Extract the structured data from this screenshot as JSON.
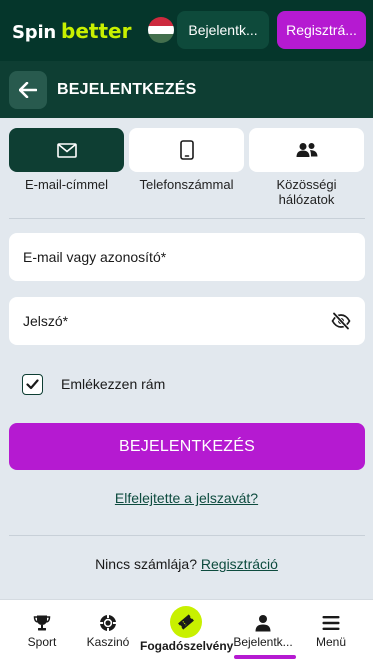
{
  "header": {
    "logo_spin": "Spin",
    "logo_better": "better",
    "flag": "hungary-flag",
    "login_button": "Bejelentk...",
    "register_button": "Regisztrá..."
  },
  "subheader": {
    "back_icon": "arrow-left-icon",
    "title": "BEJELENTKEZÉS"
  },
  "login_methods": [
    {
      "label": "E-mail-címmel",
      "icon": "envelope-icon",
      "active": true
    },
    {
      "label": "Telefonszámmal",
      "icon": "phone-icon",
      "active": false
    },
    {
      "label": "Közösségi hálózatok",
      "icon": "users-icon",
      "active": false
    }
  ],
  "form": {
    "email_label": "E-mail vagy azonosító*",
    "password_label": "Jelszó*",
    "remember_label": "Emlékezzen rám",
    "remember_checked": true,
    "submit_label": "BEJELENTKEZÉS",
    "forgot_link": "Elfelejtette a jelszavát?",
    "no_account_text": "Nincs számlája?",
    "register_link": "Regisztráció"
  },
  "bottom_nav": [
    {
      "label": "Sport",
      "icon": "trophy-icon"
    },
    {
      "label": "Kaszinó",
      "icon": "casino-chip-icon"
    },
    {
      "label": "Fogadószelvény",
      "icon": "ticket-icon"
    },
    {
      "label": "Bejelentk...",
      "icon": "user-icon",
      "active": true
    },
    {
      "label": "Menü",
      "icon": "hamburger-menu-icon"
    }
  ],
  "colors": {
    "header_bg": "#05362b",
    "subheader_bg": "#0e3e33",
    "accent_purple": "#b51ad1",
    "accent_lime": "#c8f000",
    "page_bg": "#e2e8ee"
  }
}
